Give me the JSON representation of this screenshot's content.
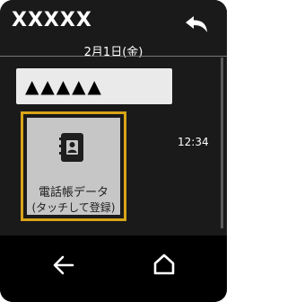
{
  "header": {
    "title": "XXXXX"
  },
  "conversation": {
    "date": "2月1日(金)",
    "message_text": "▲▲▲▲▲",
    "attachment": {
      "line1": "電話帳データ",
      "line2": "(タッチして登録)"
    },
    "time": "12:34"
  },
  "icons": {
    "back_top": "reply-back-icon",
    "contact": "contact-card-icon",
    "nav_back": "back-arrow-icon",
    "nav_home": "home-icon"
  },
  "colors": {
    "background": "#1a1a1a",
    "highlight_border": "#d9a417",
    "bubble": "#eaeaea",
    "card": "#c6c6c6"
  }
}
